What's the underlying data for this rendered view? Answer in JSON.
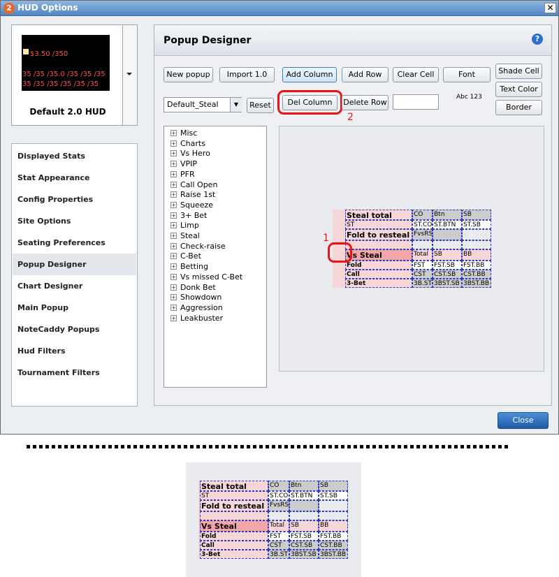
{
  "window": {
    "title": "HUD Options",
    "app_icon": "2",
    "close_glyph": "✕"
  },
  "hud": {
    "name": "Default 2.0 HUD",
    "preview_lines": [
      {
        "text": "$3.50 /350",
        "color": "#ff5050"
      },
      {
        "text": "35 /35 /35.0 /35 /35 /35",
        "color": "#ff5050"
      },
      {
        "text": "35 /35 /35 /35 /35 /35",
        "color": "#ff5050"
      }
    ]
  },
  "sidebar": {
    "items": [
      {
        "label": "Displayed Stats"
      },
      {
        "label": "Stat Appearance"
      },
      {
        "label": "Config Properties"
      },
      {
        "label": "Site Options"
      },
      {
        "label": "Seating Preferences"
      },
      {
        "label": "Popup Designer"
      },
      {
        "label": "Chart Designer"
      },
      {
        "label": "Main Popup"
      },
      {
        "label": "NoteCaddy Popups"
      },
      {
        "label": "Hud Filters"
      },
      {
        "label": "Tournament Filters"
      }
    ],
    "selected": "Popup Designer"
  },
  "designer": {
    "title": "Popup Designer",
    "help_glyph": "?",
    "buttons": {
      "new_popup": "New popup",
      "import": "Import 1.0",
      "add_column": "Add Column",
      "add_row": "Add Row",
      "clear_cell": "Clear Cell",
      "font": "Font",
      "shade_cell": "Shade Cell",
      "text_color": "Text Color",
      "border": "Border",
      "reset": "Reset",
      "del_column": "Del Column",
      "delete_row": "Delete Row"
    },
    "popup_select": "Default_Steal",
    "font_sample": "Abc 123",
    "annotations": {
      "one": "1",
      "two": "2"
    },
    "tree": [
      "Misc",
      "Charts",
      "Vs Hero",
      "VPIP",
      "PFR",
      "Call Open",
      "Raise 1st",
      "Squeeze",
      "3+ Bet",
      "Limp",
      "Steal",
      "Check-raise",
      "C-Bet",
      "Betting",
      "Vs missed C-Bet",
      "Donk Bet",
      "Showdown",
      "Aggression",
      "Leakbuster"
    ]
  },
  "grid": {
    "rows": [
      [
        "Steal total",
        "CO",
        "Btn",
        "SB"
      ],
      [
        "ST",
        "ST.CO",
        "ST.BTN",
        "ST.SB"
      ],
      [
        "Fold to resteal",
        "FvsRS",
        "",
        ""
      ],
      [
        "",
        "",
        "",
        ""
      ],
      [
        "Vs Steal",
        "Total",
        "SB",
        "BB"
      ],
      [
        "Fold",
        "FST",
        "FST.SB",
        "FST.BB"
      ],
      [
        "Call",
        "CST",
        "CST.SB",
        "CST.BB"
      ],
      [
        "3-Bet",
        "3B.ST",
        "3BST.SB",
        "3BST.BB"
      ]
    ]
  },
  "footer": {
    "close": "Close"
  }
}
